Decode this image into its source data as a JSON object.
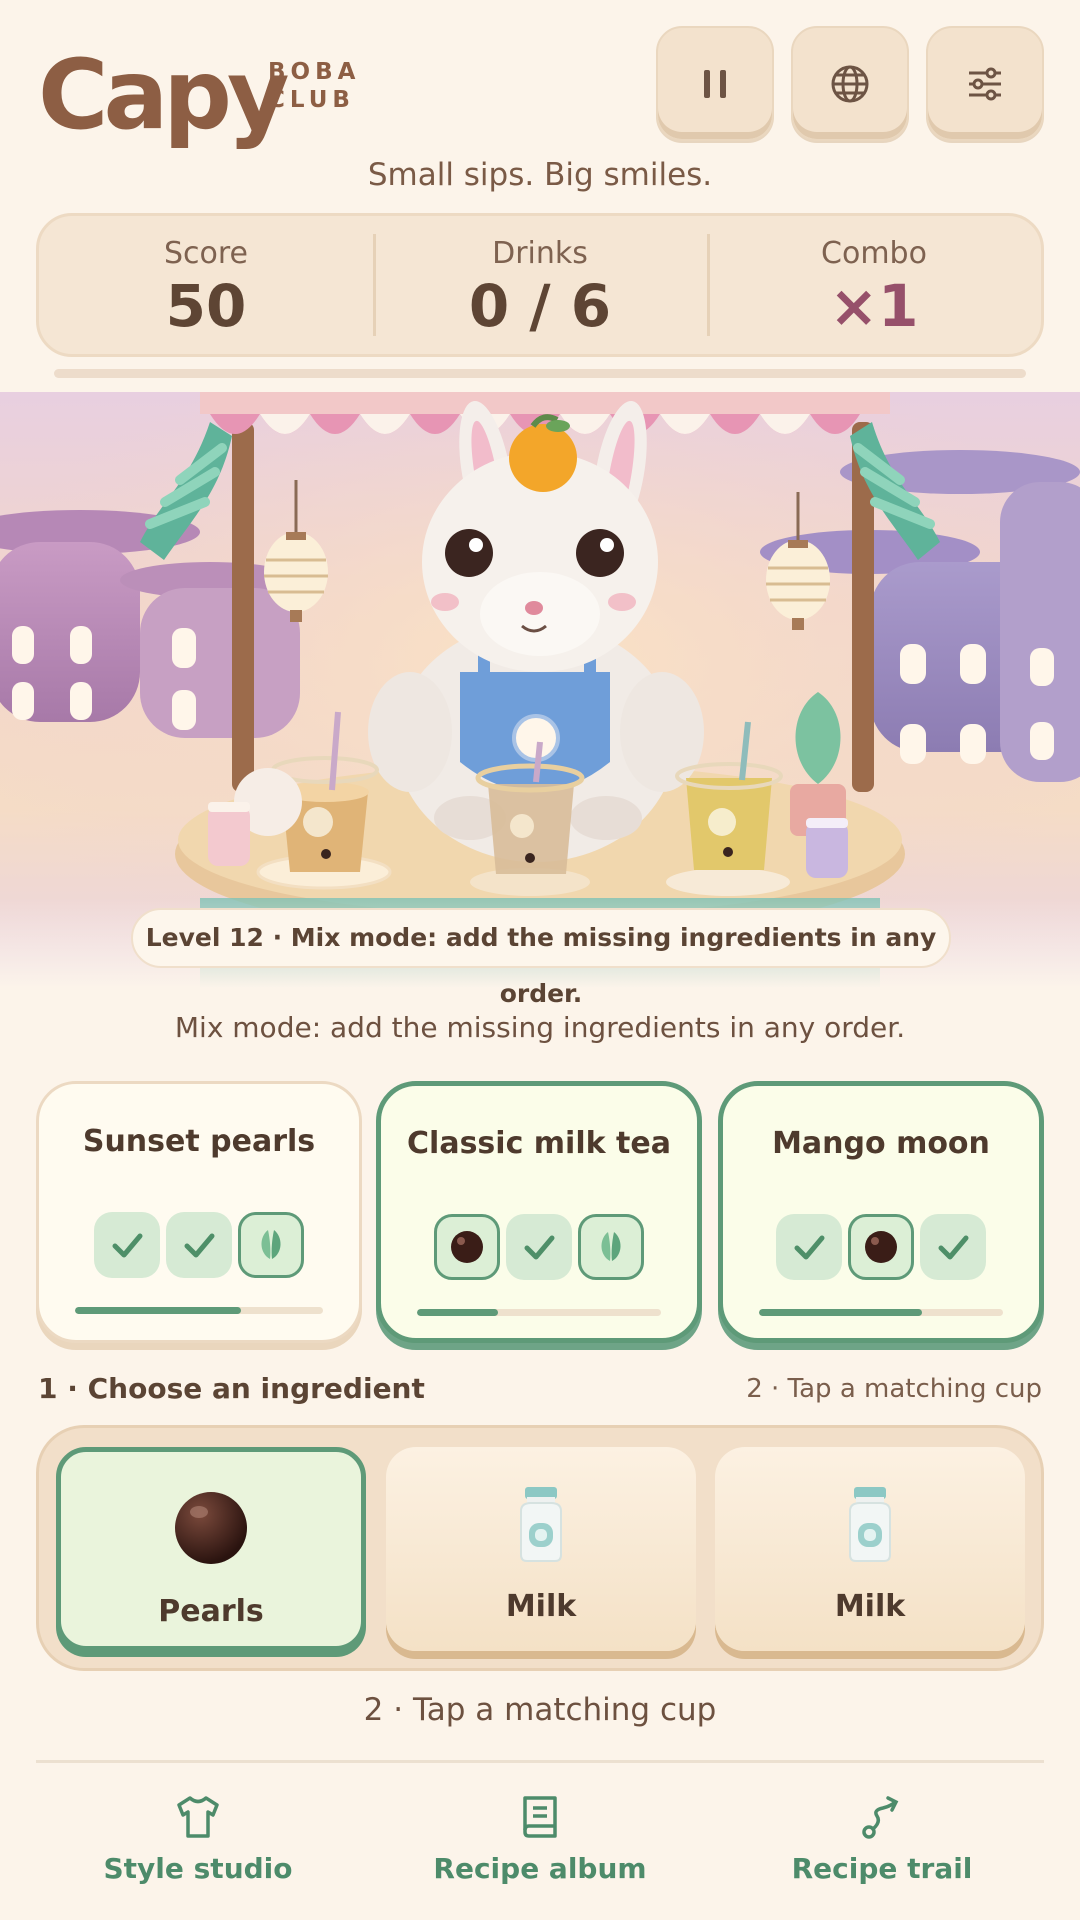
{
  "brand": {
    "name": "Capy",
    "sub_line1": "BOBA",
    "sub_line2": "CLUB",
    "tagline": "Small sips. Big smiles."
  },
  "header_buttons": [
    {
      "icon": "pause-icon"
    },
    {
      "icon": "globe-icon"
    },
    {
      "icon": "sliders-icon"
    }
  ],
  "stats": {
    "score_label": "Score",
    "score_value": "50",
    "drinks_label": "Drinks",
    "drinks_value": "0 / 6",
    "combo_label": "Combo",
    "combo_value": "×1"
  },
  "scene": {
    "banner": "Level 12 · Mix mode: add the missing ingredients in any order."
  },
  "mode_hint": "Mix mode: add the missing ingredients in any order.",
  "orders": [
    {
      "title": "Sunset pearls",
      "active": false,
      "progress": 0.67,
      "slots": [
        "done",
        "done",
        "leaf"
      ]
    },
    {
      "title": "Classic milk tea",
      "active": true,
      "progress": 0.33,
      "slots": [
        "pearl",
        "done",
        "leaf"
      ]
    },
    {
      "title": "Mango moon",
      "active": true,
      "progress": 0.67,
      "slots": [
        "done",
        "pearl",
        "done"
      ]
    }
  ],
  "steps": {
    "choose": "1 · Choose an ingredient",
    "tap_right": "2 · Tap a matching cup",
    "tap_center": "2 · Tap a matching cup"
  },
  "ingredients": [
    {
      "label": "Pearls",
      "icon": "pearl-icon",
      "selected": true
    },
    {
      "label": "Milk",
      "icon": "milk-bottle-icon",
      "selected": false
    },
    {
      "label": "Milk",
      "icon": "milk-bottle-icon",
      "selected": false
    }
  ],
  "nav": [
    {
      "label": "Style studio",
      "icon": "shirt-icon"
    },
    {
      "label": "Recipe album",
      "icon": "book-icon"
    },
    {
      "label": "Recipe trail",
      "icon": "route-icon"
    }
  ],
  "colors": {
    "accent_green": "#5e9a78",
    "brand_brown": "#8d5e44",
    "combo_plum": "#96506a"
  }
}
